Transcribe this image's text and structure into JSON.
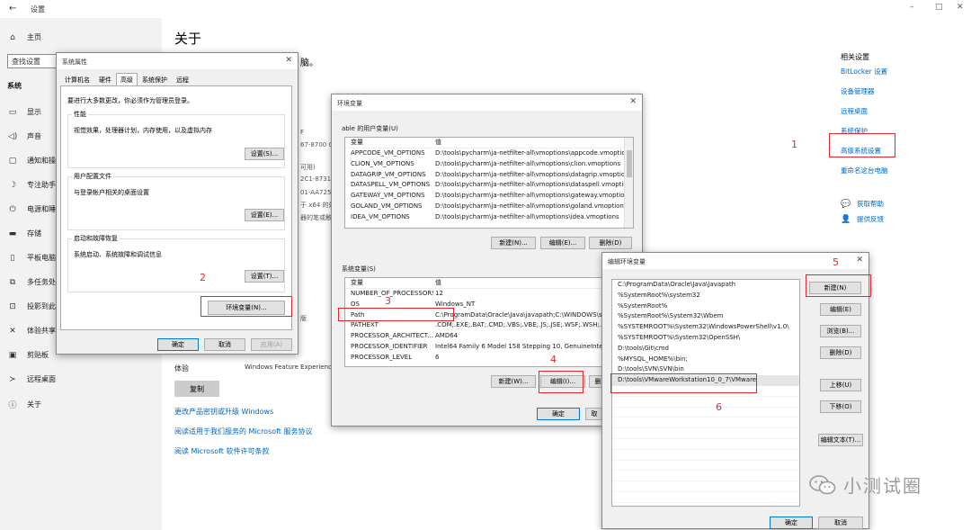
{
  "settings": {
    "title": "设置",
    "controls": [
      "–",
      "□",
      "✕"
    ],
    "home": "主页",
    "search_placeholder": "查找设置",
    "section": "系统",
    "nav": [
      {
        "label": "显示",
        "icon": "monitor-icon",
        "glyph": "▭"
      },
      {
        "label": "声音",
        "icon": "speaker-icon",
        "glyph": "◁)"
      },
      {
        "label": "通知和操作",
        "icon": "notification-icon",
        "glyph": "▢"
      },
      {
        "label": "专注助手",
        "icon": "moon-icon",
        "glyph": "☽"
      },
      {
        "label": "电源和睡眠",
        "icon": "power-icon",
        "glyph": "⏻"
      },
      {
        "label": "存储",
        "icon": "storage-icon",
        "glyph": "▬"
      },
      {
        "label": "平板电脑",
        "icon": "tablet-icon",
        "glyph": "▯"
      },
      {
        "label": "多任务处理",
        "icon": "multitask-icon",
        "glyph": "⧉"
      },
      {
        "label": "投影到此电脑",
        "icon": "project-icon",
        "glyph": "⊡"
      },
      {
        "label": "体验共享",
        "icon": "share-icon",
        "glyph": "✕"
      },
      {
        "label": "剪贴板",
        "icon": "clipboard-icon",
        "glyph": "▣"
      },
      {
        "label": "远程桌面",
        "icon": "remote-icon",
        "glyph": "≻"
      },
      {
        "label": "关于",
        "icon": "info-icon",
        "glyph": "ⓘ"
      }
    ],
    "page_title": "关于",
    "fragments": [
      "脑。",
      "F",
      "67-8700 CP",
      "可用)",
      "2C1-8731-8",
      "01-AA725",
      "于 x64 的处",
      "器的笔或触",
      "版"
    ],
    "experience_label": "体验",
    "experience_value": "Windows Feature Experience",
    "copy": "复制",
    "links": [
      "更改产品密钥或升级 Windows",
      "阅读适用于我们服务的 Microsoft 服务协议",
      "阅读 Microsoft 软件许可条款"
    ],
    "related_title": "相关设置",
    "related_links": [
      "BitLocker 设置",
      "设备管理器",
      "远程桌面",
      "系统保护",
      "高级系统设置",
      "重命名这台电脑"
    ],
    "help": [
      {
        "label": "获取帮助",
        "icon": "help-icon"
      },
      {
        "label": "提供反馈",
        "icon": "feedback-icon"
      }
    ]
  },
  "system_properties": {
    "title": "系统属性",
    "tabs": [
      "计算机名",
      "硬件",
      "高级",
      "系统保护",
      "远程"
    ],
    "intro": "要进行大多数更改，你必须作为管理员登录。",
    "groups": [
      {
        "title": "性能",
        "desc": "视觉效果，处理器计划，内存使用，以及虚拟内存",
        "button": "设置(S)..."
      },
      {
        "title": "用户配置文件",
        "desc": "与登录帐户相关的桌面设置",
        "button": "设置(E)..."
      },
      {
        "title": "启动和故障恢复",
        "desc": "系统启动、系统故障和调试信息",
        "button": "设置(T)..."
      }
    ],
    "env_button": "环境变量(N)...",
    "ok": "确定",
    "cancel": "取消",
    "apply": "应用(A)"
  },
  "env_vars": {
    "title": "环境变量",
    "user_section": "able 的用户变量(U)",
    "col_var": "变量",
    "col_val": "值",
    "user_vars": [
      [
        "APPCODE_VM_OPTIONS",
        "D:\\tools\\pycharm\\ja-netfilter-all\\vmoptions\\appcode.vmoptio..."
      ],
      [
        "CLION_VM_OPTIONS",
        "D:\\tools\\pycharm\\ja-netfilter-all\\vmoptions\\clion.vmoptions"
      ],
      [
        "DATAGRIP_VM_OPTIONS",
        "D:\\tools\\pycharm\\ja-netfilter-all\\vmoptions\\datagrip.vmoptions"
      ],
      [
        "DATASPELL_VM_OPTIONS",
        "D:\\tools\\pycharm\\ja-netfilter-all\\vmoptions\\dataspell.vmoptions"
      ],
      [
        "GATEWAY_VM_OPTIONS",
        "D:\\tools\\pycharm\\ja-netfilter-all\\vmoptions\\gateway.vmoptions"
      ],
      [
        "GOLAND_VM_OPTIONS",
        "D:\\tools\\pycharm\\ja-netfilter-all\\vmoptions\\goland.vmoptions"
      ],
      [
        "IDEA_VM_OPTIONS",
        "D:\\tools\\pycharm\\ja-netfilter-all\\vmoptions\\idea.vmoptions"
      ]
    ],
    "user_buttons": [
      "新建(N)...",
      "编辑(E)...",
      "删除(D)"
    ],
    "system_section": "系统变量(S)",
    "sys_vars": [
      [
        "NUMBER_OF_PROCESSORS",
        "12"
      ],
      [
        "OS",
        "Windows_NT"
      ],
      [
        "Path",
        "C:\\ProgramData\\Oracle\\Java\\javapath;C:\\WINDOWS\\syste"
      ],
      [
        "PATHEXT",
        ".COM;.EXE;.BAT;.CMD;.VBS;.VBE;.JS;.JSE;.WSF;.WSH;.MSC"
      ],
      [
        "PROCESSOR_ARCHITECT...",
        "AMD64"
      ],
      [
        "PROCESSOR_IDENTIFIER",
        "Intel64 Family 6 Model 158 Stepping 10, GenuineIntel"
      ],
      [
        "PROCESSOR_LEVEL",
        "6"
      ]
    ],
    "sys_buttons": [
      "新建(W)...",
      "编辑(I)...",
      "删"
    ],
    "ok": "确定",
    "cancel": "取"
  },
  "edit_env": {
    "title": "编辑环境变量",
    "entries": [
      "C:\\ProgramData\\Oracle\\Java\\javapath",
      "%SystemRoot%\\system32",
      "%SystemRoot%",
      "%SystemRoot%\\System32\\Wbem",
      "%SYSTEMROOT%\\System32\\WindowsPowerShell\\v1.0\\",
      "%SYSTEMROOT%\\System32\\OpenSSH\\",
      "D:\\tools\\Git\\cmd",
      "%MYSQL_HOME%\\bin;",
      "D:\\tools\\SVN\\SVN\\bin",
      "D:\\tools\\VMwareWorkstation10_0_7\\VMware"
    ],
    "buttons": [
      "新建(N)",
      "编辑(E)",
      "浏览(B)...",
      "删除(D)",
      "上移(U)",
      "下移(O)",
      "编辑文本(T)..."
    ],
    "ok": "确定",
    "cancel": "取消"
  },
  "annotations": [
    "1",
    "2",
    "3",
    "4",
    "5",
    "6"
  ],
  "watermark": "小测试圈",
  "colors": {
    "accent": "#0067c0",
    "annotation": "#e5262f",
    "sidebar": "#f2f2f2"
  }
}
